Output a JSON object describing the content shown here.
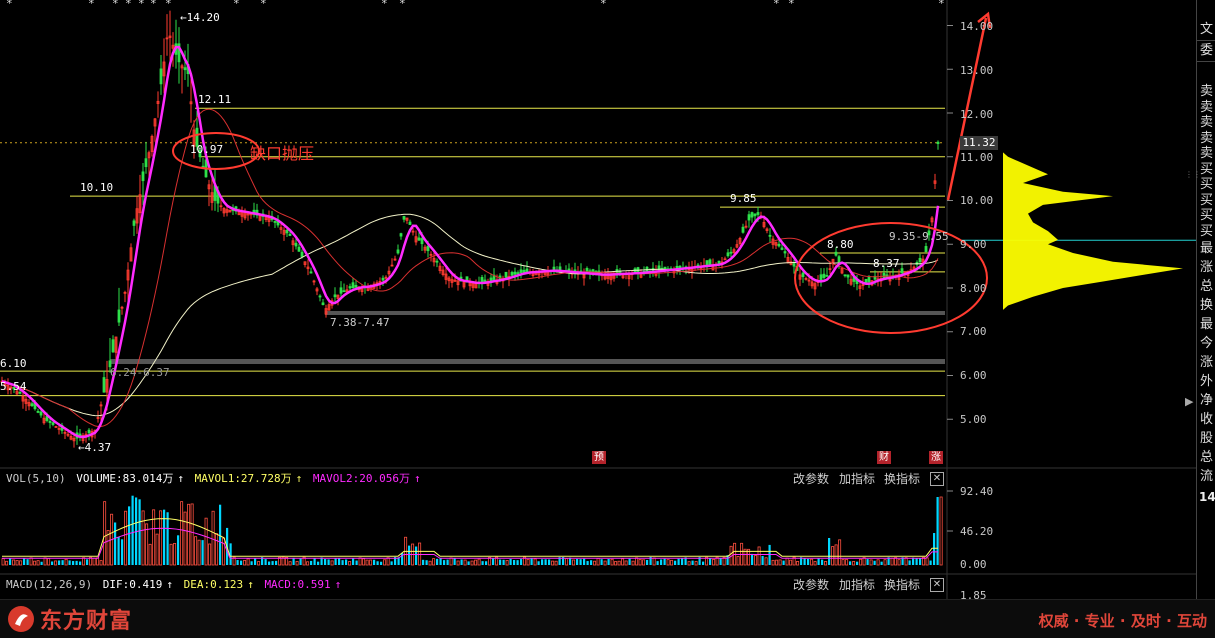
{
  "main_chart": {
    "price_axis_labels": [
      "14.00",
      "13.00",
      "12.00",
      "11.00",
      "10.00",
      "9.00",
      "8.00",
      "7.00",
      "6.00",
      "5.00"
    ],
    "current_price": "11.32",
    "price_labels": {
      "high": "14.20",
      "low": "4.37",
      "ma_high": "12.11",
      "gap": "10.97",
      "level_1010": "10.10",
      "level_985": "9.85",
      "level_880": "8.80",
      "level_837": "8.37",
      "range_935": "9.35-9.55",
      "range_738": "7.38-7.47",
      "range_624": "6.24-6.37",
      "left_610": "6.10",
      "left_554": "5.54"
    },
    "annotation": "缺口抛压",
    "markers": [
      "预",
      "财",
      "涨"
    ],
    "stars": [
      "*",
      "*",
      "*",
      "*",
      "*",
      "*",
      "*",
      "*",
      "*",
      "*",
      "*",
      "*",
      "*",
      "*",
      "*"
    ]
  },
  "volume_panel": {
    "name": "VOL(5,10)",
    "volume": "VOLUME:83.014万",
    "mavol1": "MAVOL1:27.728万",
    "mavol2": "MAVOL2:20.056万",
    "axis": [
      "92.40",
      "46.20",
      "0.00"
    ],
    "buttons": {
      "params": "改参数",
      "add": "加指标",
      "swap": "换指标"
    }
  },
  "macd_panel": {
    "name": "MACD(12,26,9)",
    "dif": "DIF:0.419",
    "dea": "DEA:0.123",
    "macd": "MACD:0.591",
    "axis": [
      "1.85"
    ],
    "buttons": {
      "params": "改参数",
      "add": "加指标",
      "swap": "换指标"
    }
  },
  "sidebar": {
    "tabs": [
      "文",
      "委"
    ],
    "labels": [
      "卖",
      "卖",
      "卖",
      "卖",
      "卖",
      "买",
      "买",
      "买",
      "买",
      "买",
      "最",
      "涨",
      "总",
      "换",
      "最",
      "今",
      "涨",
      "外",
      "净",
      "收",
      "股",
      "总",
      "流"
    ],
    "value": "14"
  },
  "footer": {
    "brand": "东方财富",
    "slogan": "权威 · 专业 · 及时 · 互动"
  },
  "colors": {
    "up": "#ff3b30",
    "down": "#00d7ff",
    "ma_magenta": "#ff2bff",
    "ma_yellow": "#ffff66",
    "ma_red": "#d83030",
    "ma_white": "#f2f2c8",
    "volume_profile": "#ffff00"
  }
}
